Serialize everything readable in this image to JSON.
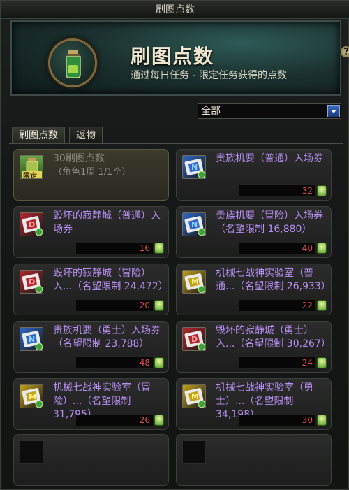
{
  "window": {
    "title": "刷图点数"
  },
  "banner": {
    "icon": "potion-icon",
    "title": "刷图点数",
    "subtitle": "通过每日任务 - 限定任务获得的点数"
  },
  "help": {
    "label": "?"
  },
  "filter": {
    "selected": "全部"
  },
  "tabs": [
    {
      "label": "刷图点数",
      "active": true
    },
    {
      "label": "返物",
      "active": false
    }
  ],
  "items": [
    {
      "name": "30刷图点数",
      "sub": "（角色1周 1/1个）",
      "price": "",
      "icon": "limited-potion-icon",
      "badge": "限定",
      "highlight": true
    },
    {
      "name": "贵族机要（普通）入场券",
      "sub": "",
      "price": "32",
      "icon": "ticket-n-icon",
      "badge": "N"
    },
    {
      "name": "毁坏的寂静城（普通）入场券",
      "sub": "",
      "price": "16",
      "icon": "ticket-d-icon",
      "badge": "D"
    },
    {
      "name": "贵族机要（冒险）入场券（名望限制 16,880）",
      "sub": "",
      "price": "40",
      "icon": "ticket-n-icon",
      "badge": "N"
    },
    {
      "name": "毁坏的寂静城（冒险）入...（名望限制 24,472）",
      "sub": "",
      "price": "20",
      "icon": "ticket-d-icon",
      "badge": "D"
    },
    {
      "name": "机械七战神实验室（普通...（名望限制 26,933）",
      "sub": "",
      "price": "22",
      "icon": "ticket-m-icon",
      "badge": "M"
    },
    {
      "name": "贵族机要（勇士）入场券（名望限制 23,788）",
      "sub": "",
      "price": "48",
      "icon": "ticket-n-icon",
      "badge": "N"
    },
    {
      "name": "毁坏的寂静城（勇士）入...（名望限制 30,267）",
      "sub": "",
      "price": "24",
      "icon": "ticket-d-icon",
      "badge": "D"
    },
    {
      "name": "机械七战神实验室（冒险）...（名望限制 31,795）",
      "sub": "",
      "price": "26",
      "icon": "ticket-m-icon",
      "badge": "M"
    },
    {
      "name": "机械七战神实验室（勇士）...（名望限制 34,198）",
      "sub": "",
      "price": "30",
      "icon": "ticket-m-icon",
      "badge": "M"
    },
    {
      "name": "",
      "sub": "",
      "price": "",
      "icon": "empty-slot",
      "badge": ""
    },
    {
      "name": "",
      "sub": "",
      "price": "",
      "icon": "empty-slot",
      "badge": ""
    }
  ],
  "colors": {
    "item_name": "#b68ff2",
    "price": "#e24848",
    "dimmed": "#8e8b7e"
  }
}
